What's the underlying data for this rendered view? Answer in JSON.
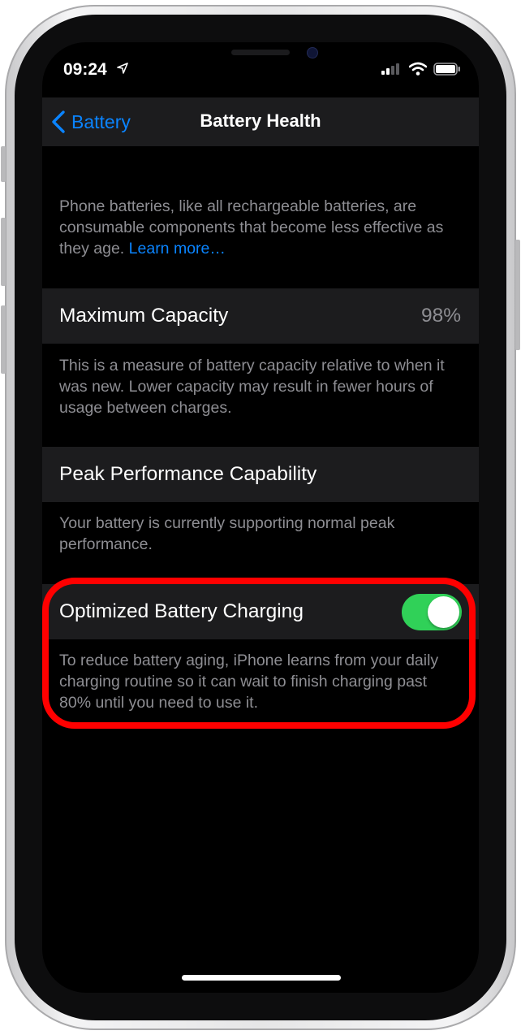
{
  "status_bar": {
    "time": "09:24",
    "icons": [
      "location-arrow-icon",
      "cellular-signal-icon",
      "wifi-icon",
      "battery-icon"
    ]
  },
  "nav": {
    "back_label": "Battery",
    "title": "Battery Health"
  },
  "intro": {
    "text": "Phone batteries, like all rechargeable batteries, are consumable components that become less effective as they age. ",
    "link": "Learn more…"
  },
  "maximum_capacity": {
    "label": "Maximum Capacity",
    "value": "98%",
    "footer": "This is a measure of battery capacity relative to when it was new. Lower capacity may result in fewer hours of usage between charges."
  },
  "peak_performance": {
    "label": "Peak Performance Capability",
    "footer": "Your battery is currently supporting normal peak performance."
  },
  "optimized_charging": {
    "label": "Optimized Battery Charging",
    "enabled": true,
    "footer": "To reduce battery aging, iPhone learns from your daily charging routine so it can wait to finish charging past 80% until you need to use it."
  },
  "colors": {
    "accent": "#0a84ff",
    "toggle_on": "#30d158",
    "highlight": "#ff0000",
    "row_bg": "#1c1c1e",
    "secondary_text": "#8e8e93"
  }
}
